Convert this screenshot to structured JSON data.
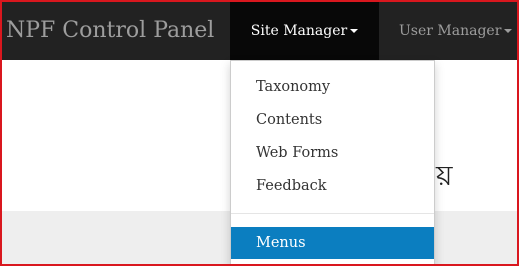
{
  "navbar": {
    "brand": "NPF Control Panel",
    "items": [
      {
        "label": "Site Manager",
        "active": true,
        "has_caret": true
      },
      {
        "label": "User Manager",
        "active": false,
        "has_caret": true
      }
    ]
  },
  "dropdown": {
    "items": [
      {
        "label": "Taxonomy"
      },
      {
        "label": "Contents"
      },
      {
        "label": "Web Forms"
      },
      {
        "label": "Feedback"
      }
    ],
    "after_divider": [
      {
        "label": "Menus",
        "highlighted": true
      }
    ]
  },
  "page": {
    "heading_fragment": "য়"
  },
  "colors": {
    "navbar_bg": "#222222",
    "active_nav_bg": "#080808",
    "highlight": "#0b7ec0",
    "frame_border": "#d9171e"
  }
}
